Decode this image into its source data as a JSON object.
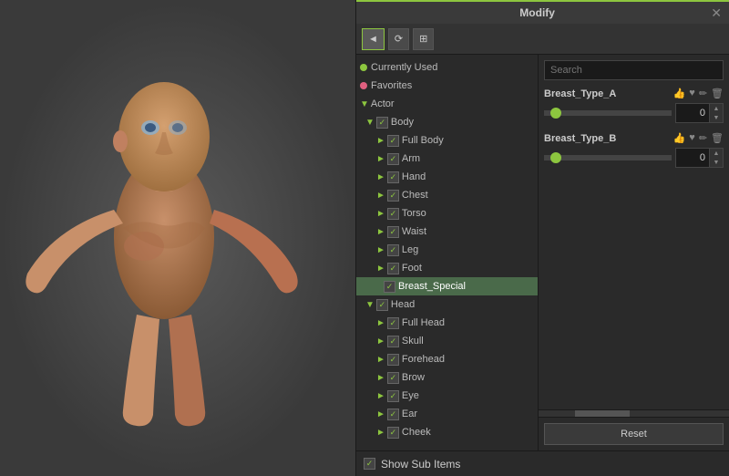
{
  "title": "Modify",
  "toolbar": {
    "buttons": [
      {
        "label": "◄",
        "id": "back-btn"
      },
      {
        "label": "⟳",
        "id": "refresh-btn"
      },
      {
        "label": "⊞",
        "id": "grid-btn"
      }
    ]
  },
  "tree": {
    "items": [
      {
        "id": "currently-used",
        "label": "Currently Used",
        "indent": 0,
        "type": "dot-green",
        "level": 0
      },
      {
        "id": "favorites",
        "label": "Favorites",
        "indent": 0,
        "type": "dot-pink",
        "level": 0
      },
      {
        "id": "actor",
        "label": "Actor",
        "indent": 0,
        "type": "expand",
        "level": 0
      },
      {
        "id": "body",
        "label": "Body",
        "indent": 8,
        "type": "expand-check",
        "level": 1
      },
      {
        "id": "full-body",
        "label": "Full Body",
        "indent": 20,
        "type": "expand-check",
        "level": 2
      },
      {
        "id": "arm",
        "label": "Arm",
        "indent": 20,
        "type": "expand-check",
        "level": 2
      },
      {
        "id": "hand",
        "label": "Hand",
        "indent": 20,
        "type": "expand-check",
        "level": 2
      },
      {
        "id": "chest",
        "label": "Chest",
        "indent": 20,
        "type": "expand-check",
        "level": 2
      },
      {
        "id": "torso",
        "label": "Torso",
        "indent": 20,
        "type": "expand-check",
        "level": 2
      },
      {
        "id": "waist",
        "label": "Waist",
        "indent": 20,
        "type": "expand-check",
        "level": 2
      },
      {
        "id": "leg",
        "label": "Leg",
        "indent": 20,
        "type": "expand-check",
        "level": 2
      },
      {
        "id": "foot",
        "label": "Foot",
        "indent": 20,
        "type": "expand-check",
        "level": 2
      },
      {
        "id": "breast-special",
        "label": "Breast_Special",
        "indent": 20,
        "type": "check-only",
        "level": 2,
        "selected": true
      },
      {
        "id": "head",
        "label": "Head",
        "indent": 8,
        "type": "expand-check",
        "level": 1
      },
      {
        "id": "full-head",
        "label": "Full Head",
        "indent": 20,
        "type": "expand-check",
        "level": 2
      },
      {
        "id": "skull",
        "label": "Skull",
        "indent": 20,
        "type": "expand-check",
        "level": 2
      },
      {
        "id": "forehead",
        "label": "Forehead",
        "indent": 20,
        "type": "expand-check",
        "level": 2
      },
      {
        "id": "brow",
        "label": "Brow",
        "indent": 20,
        "type": "expand-check",
        "level": 2
      },
      {
        "id": "eye",
        "label": "Eye",
        "indent": 20,
        "type": "expand-check",
        "level": 2
      },
      {
        "id": "ear",
        "label": "Ear",
        "indent": 20,
        "type": "expand-check",
        "level": 2
      },
      {
        "id": "cheek",
        "label": "Cheek",
        "indent": 20,
        "type": "expand-check",
        "level": 2
      }
    ]
  },
  "properties": {
    "search_placeholder": "Search",
    "items": [
      {
        "id": "breast-type-a",
        "name": "Breast_Type_A",
        "value": "0",
        "slider_pct": 5
      },
      {
        "id": "breast-type-b",
        "name": "Breast_Type_B",
        "value": "0",
        "slider_pct": 5
      }
    ]
  },
  "footer": {
    "show_sub_items_label": "Show Sub Items",
    "reset_label": "Reset"
  }
}
